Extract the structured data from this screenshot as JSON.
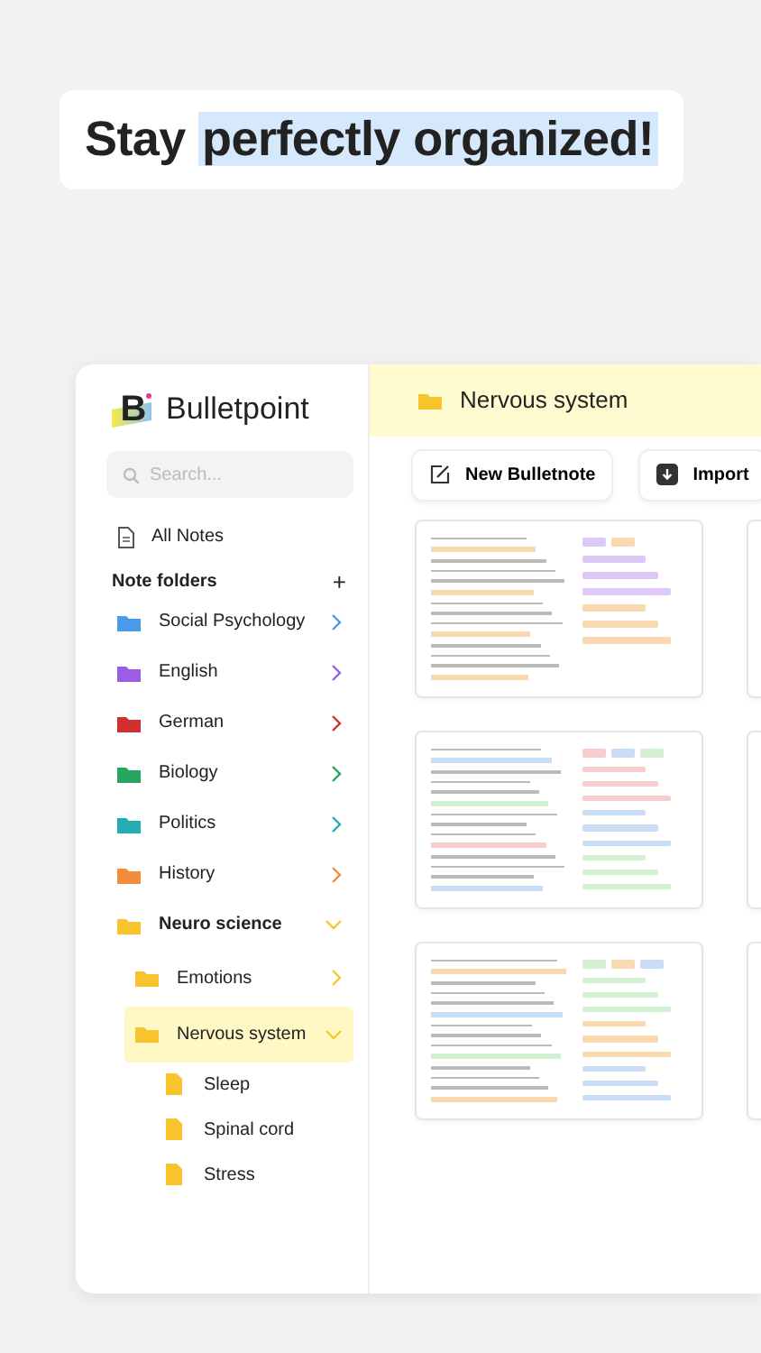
{
  "headline": {
    "text": "Stay ",
    "highlight": "perfectly organized!"
  },
  "sidebar": {
    "logo_letter": "B",
    "app_name": "Bulletpoint",
    "search": {
      "placeholder": "Search..."
    },
    "all_notes": "All Notes",
    "folders_heading": "Note folders",
    "add": "+",
    "items": [
      {
        "kind": "folder",
        "label": "Social Psychology",
        "color": "#4a9be8",
        "expanded": false,
        "selected": false
      },
      {
        "kind": "folder",
        "label": "English",
        "color": "#9b5de5",
        "expanded": false,
        "selected": false
      },
      {
        "kind": "folder",
        "label": "German",
        "color": "#d22f2f",
        "expanded": false,
        "selected": false
      },
      {
        "kind": "folder",
        "label": "Biology",
        "color": "#25a55f",
        "expanded": false,
        "selected": false
      },
      {
        "kind": "folder",
        "label": "Politics",
        "color": "#22adb5",
        "expanded": false,
        "selected": false
      },
      {
        "kind": "folder",
        "label": "History",
        "color": "#f28c3c",
        "expanded": false,
        "selected": false
      },
      {
        "kind": "folder",
        "label": "Neuro science",
        "color": "#f7c42e",
        "expanded": true,
        "selected": false,
        "children": [
          {
            "kind": "folder",
            "label": "Emotions",
            "color": "#f7c42e",
            "expanded": false,
            "selected": false
          },
          {
            "kind": "folder",
            "label": "Nervous system",
            "color": "#f7c42e",
            "expanded": true,
            "selected": true,
            "children": [
              {
                "kind": "note",
                "label": "Sleep",
                "color": "#f7c42e",
                "selected": false
              },
              {
                "kind": "note",
                "label": "Spinal cord",
                "color": "#f7c42e",
                "selected": false
              },
              {
                "kind": "note",
                "label": "Stress",
                "color": "#f7c42e",
                "selected": false
              }
            ]
          }
        ]
      }
    ]
  },
  "main": {
    "title": "Nervous system",
    "buttons": [
      {
        "kind": "new",
        "label": "New Bulletnote"
      },
      {
        "kind": "import",
        "label": "Import"
      }
    ],
    "note_previews": [
      {
        "tags": [
          {
            "color": "#dcc9f7"
          },
          {
            "color": "#fbd9b0"
          }
        ]
      },
      {
        "tags": [
          {
            "color": "#f8cccc"
          },
          {
            "color": "#c9dcf6"
          },
          {
            "color": "#d3f0d3"
          }
        ]
      },
      {
        "tags": [
          {
            "color": "#d3f0d3"
          },
          {
            "color": "#fbd9b0"
          },
          {
            "color": "#c9dcf6"
          }
        ]
      }
    ]
  }
}
